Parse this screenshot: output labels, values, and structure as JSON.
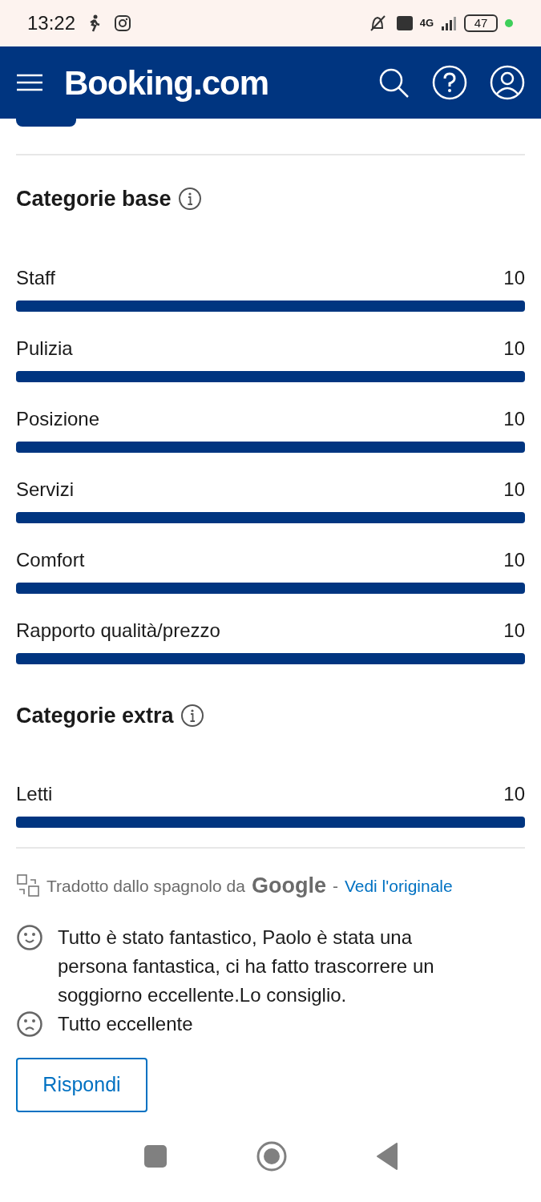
{
  "status_bar": {
    "time": "13:22",
    "network": "4G",
    "battery": "47"
  },
  "header": {
    "logo": "Booking.com"
  },
  "sections": [
    {
      "title": "Categorie base",
      "scores": [
        {
          "label": "Staff",
          "score": "10",
          "level": 1
        },
        {
          "label": "Pulizia",
          "score": "10",
          "level": 1
        },
        {
          "label": "Posizione",
          "score": "10",
          "level": 1
        },
        {
          "label": "Servizi",
          "score": "10",
          "level": 1
        },
        {
          "label": "Comfort",
          "score": "10",
          "level": 1
        },
        {
          "label": "Rapporto qualità/prezzo",
          "score": "10",
          "level": 1
        }
      ]
    },
    {
      "title": "Categorie extra",
      "scores": [
        {
          "label": "Letti",
          "score": "10",
          "level": 1
        }
      ]
    }
  ],
  "translation": {
    "text": "Tradotto dallo spagnolo da",
    "brand": "Google",
    "separator": "-",
    "link": "Vedi l'originale"
  },
  "review": [
    {
      "kind": "positive",
      "text": "Tutto è stato fantastico, Paolo è stata una persona fantastica, ci ha fatto trascorrere un soggiorno eccellente.Lo consiglio."
    },
    {
      "kind": "negative",
      "text": "Tutto eccellente"
    }
  ],
  "reply_button": "Rispondi"
}
